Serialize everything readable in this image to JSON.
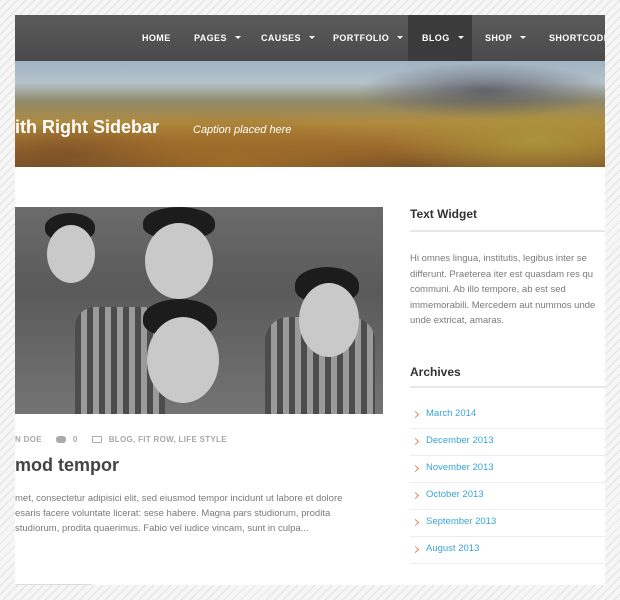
{
  "nav": {
    "items": [
      {
        "label": "HOME",
        "dropdown": false
      },
      {
        "label": "PAGES",
        "dropdown": true
      },
      {
        "label": "CAUSES",
        "dropdown": true
      },
      {
        "label": "PORTFOLIO",
        "dropdown": true
      },
      {
        "label": "BLOG",
        "dropdown": true,
        "active": true
      },
      {
        "label": "SHOP",
        "dropdown": true
      },
      {
        "label": "SHORTCODES",
        "dropdown": false
      }
    ]
  },
  "banner": {
    "title": "ith Right Sidebar",
    "caption": "Caption placed here"
  },
  "post": {
    "meta": {
      "author": "N DOE",
      "comments": "0",
      "categories": "BLOG, FIT ROW, LIFE STYLE",
      "comment_icon": "comment-icon",
      "category_icon": "folder-icon"
    },
    "title": "mod tempor",
    "excerpt": [
      "met, consectetur adipisici elit, sed eiusmod tempor incidunt ut labore et dolore",
      "esaris facere voluntate licerat: sese habere. Magna pars studiorum, prodita",
      "studiorum, prodita quaerimus. Fabio vel iudice vincam, sunt in culpa..."
    ]
  },
  "sidebar": {
    "text_widget": {
      "title": "Text Widget",
      "lines": [
        "Hi omnes lingua, institutis, legibus inter se",
        "differunt. Praeterea iter est quasdam res qu",
        "communi. Ab illo tempore, ab est sed",
        "immemorabili. Mercedem aut nummos unde",
        "unde extricat, amaras."
      ]
    },
    "archives": {
      "title": "Archives",
      "items": [
        "March 2014",
        "December 2013",
        "November 2013",
        "October 2013",
        "September 2013",
        "August 2013"
      ]
    }
  },
  "colors": {
    "nav_background": "#4f4f4f",
    "nav_active": "#3b3b3b",
    "link_accent": "#3aa4d8",
    "chevron_accent": "#e08a5a"
  }
}
